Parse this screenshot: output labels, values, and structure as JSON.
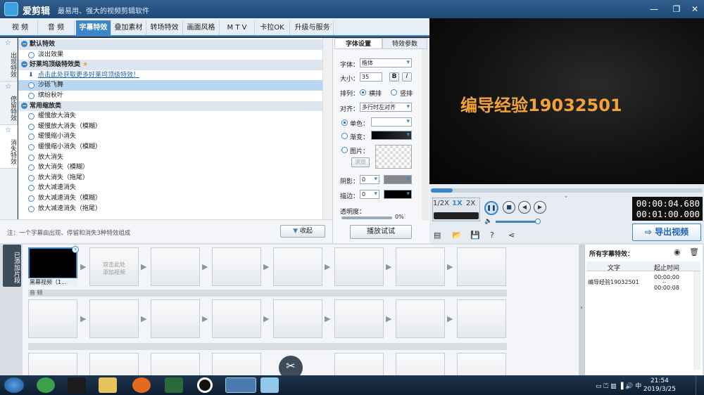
{
  "app": {
    "title": "爱剪辑",
    "slogan": "最易用、强大的视频剪辑软件"
  },
  "tabs": [
    "视 频",
    "音 频",
    "字幕特效",
    "叠加素材",
    "转场特效",
    "画面风格",
    "M T V",
    "卡拉OK",
    "升级与服务"
  ],
  "left_tabs": [
    "出现特效",
    "停留特效",
    "消失特效"
  ],
  "effects": {
    "group1": "默认特效",
    "group1_items": [
      "淡出效果"
    ],
    "group2": "好莱坞顶级特效类",
    "group2_link": "点击此处获取更多好莱坞顶级特效！",
    "group2_items": [
      "沙砾飞舞",
      "缤纷秋叶"
    ],
    "group3": "常用缩放类",
    "group3_items": [
      "缓慢放大消失",
      "缓慢放大消失（模糊）",
      "缓慢缩小消失",
      "缓慢缩小消失（模糊）",
      "放大消失",
      "放大消失（模糊）",
      "放大消失（拖尾）",
      "放大减速消失",
      "放大减速消失（模糊）",
      "放大减速消失（拖尾）"
    ]
  },
  "footer": {
    "note": "注：一个字幕由出现、停留和消失3种特效组成",
    "collapse": "收起"
  },
  "props": {
    "tab_font": "字体设置",
    "tab_effect": "特效参数",
    "font_label": "字体：",
    "font_value": "楷体",
    "size_label": "大小：",
    "size_value": "35",
    "bold": "B",
    "italic": "I",
    "arrange_label": "排列：",
    "horiz": "横排",
    "vert": "竖排",
    "align_label": "对齐：",
    "align_value": "多行时左对齐",
    "solid": "单色：",
    "gradient": "渐变：",
    "image": "图片：",
    "browse": "浏览",
    "shadow_label": "阴影：",
    "shadow_value": "0",
    "stroke_label": "描边：",
    "stroke_value": "0",
    "opacity_label": "透明度：",
    "opacity_value": "0%",
    "play_test": "播放试试"
  },
  "preview": {
    "caption": "编导经验19032501"
  },
  "player": {
    "speeds": [
      "1/2X",
      "1X",
      "2X"
    ],
    "current_time": "00:00:04.680",
    "total_time": "00:01:00.000",
    "progress": 0.08,
    "export": "导出视频"
  },
  "tracks": {
    "label": "已添加片段",
    "clip1": "黑幕视频（1...",
    "add_hint": "双击此处\n添加视频",
    "audio": "音 频"
  },
  "right_panel": {
    "title": "所有字幕特效：",
    "col_text": "文字",
    "col_time": "起止时间",
    "row_text": "编导经验19032501",
    "row_start": "00:00:00",
    "row_dash": "--",
    "row_end": "00:00:08"
  },
  "taskbar": {
    "time": "21:54",
    "date": "2019/3/25"
  },
  "colors": {
    "accent": "#3c86c8",
    "caption": "#f2a23a"
  }
}
